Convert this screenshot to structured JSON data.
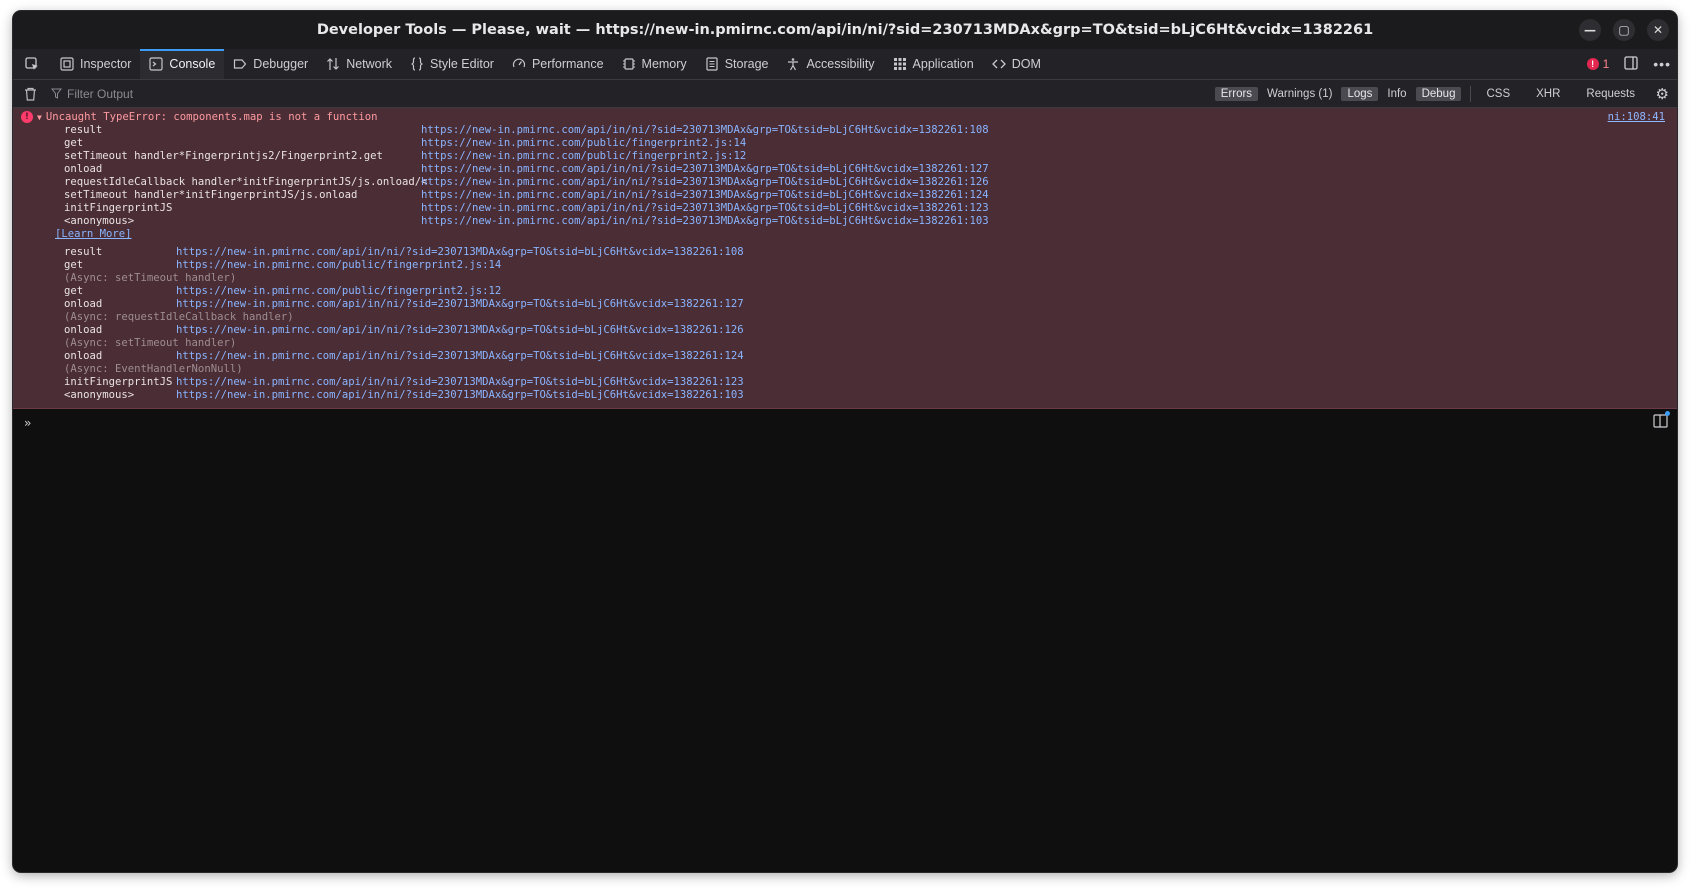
{
  "window": {
    "title": "Developer Tools — Please, wait — https://new-in.pmirnc.com/api/in/ni/?sid=230713MDAx&grp=TO&tsid=bLjC6Ht&vcidx=1382261",
    "controls": {
      "minimize": "—",
      "maximize": "▢",
      "close": "✕"
    }
  },
  "toolbar": {
    "tabs": [
      {
        "label": "Inspector",
        "icon": "inspector-icon"
      },
      {
        "label": "Console",
        "icon": "console-icon",
        "selected": true
      },
      {
        "label": "Debugger",
        "icon": "debugger-icon"
      },
      {
        "label": "Network",
        "icon": "network-icon"
      },
      {
        "label": "Style Editor",
        "icon": "style-editor-icon"
      },
      {
        "label": "Performance",
        "icon": "performance-icon"
      },
      {
        "label": "Memory",
        "icon": "memory-icon"
      },
      {
        "label": "Storage",
        "icon": "storage-icon"
      },
      {
        "label": "Accessibility",
        "icon": "accessibility-icon"
      },
      {
        "label": "Application",
        "icon": "application-icon"
      },
      {
        "label": "DOM",
        "icon": "dom-icon"
      }
    ],
    "error_count": "1"
  },
  "filterbar": {
    "placeholder": "Filter Output",
    "buttons": [
      {
        "label": "Errors",
        "on": true
      },
      {
        "label": "Warnings (1)",
        "on": false
      },
      {
        "label": "Logs",
        "on": true
      },
      {
        "label": "Info",
        "on": false
      },
      {
        "label": "Debug",
        "on": true
      }
    ],
    "net_buttons": [
      "CSS",
      "XHR",
      "Requests"
    ]
  },
  "error": {
    "message": "Uncaught TypeError: components.map is not a function",
    "location": "ni:108:41",
    "stack": [
      {
        "fn": "result",
        "url": "https://new-in.pmirnc.com/api/in/ni/?sid=230713MDAx&grp=TO&tsid=bLjC6Ht&vcidx=1382261:108"
      },
      {
        "fn": "get",
        "url": "https://new-in.pmirnc.com/public/fingerprint2.js:14"
      },
      {
        "fn": "setTimeout handler*Fingerprintjs2/Fingerprint2.get",
        "url": "https://new-in.pmirnc.com/public/fingerprint2.js:12"
      },
      {
        "fn": "onload",
        "url": "https://new-in.pmirnc.com/api/in/ni/?sid=230713MDAx&grp=TO&tsid=bLjC6Ht&vcidx=1382261:127"
      },
      {
        "fn": "requestIdleCallback handler*initFingerprintJS/js.onload/<",
        "url": "https://new-in.pmirnc.com/api/in/ni/?sid=230713MDAx&grp=TO&tsid=bLjC6Ht&vcidx=1382261:126"
      },
      {
        "fn": "setTimeout handler*initFingerprintJS/js.onload",
        "url": "https://new-in.pmirnc.com/api/in/ni/?sid=230713MDAx&grp=TO&tsid=bLjC6Ht&vcidx=1382261:124"
      },
      {
        "fn": "initFingerprintJS",
        "url": "https://new-in.pmirnc.com/api/in/ni/?sid=230713MDAx&grp=TO&tsid=bLjC6Ht&vcidx=1382261:123"
      },
      {
        "fn": "<anonymous>",
        "url": "https://new-in.pmirnc.com/api/in/ni/?sid=230713MDAx&grp=TO&tsid=bLjC6Ht&vcidx=1382261:103"
      }
    ],
    "learn_more": "[Learn More]",
    "async_trace": [
      {
        "fn": "result",
        "url": "https://new-in.pmirnc.com/api/in/ni/?sid=230713MDAx&grp=TO&tsid=bLjC6Ht&vcidx=1382261:108"
      },
      {
        "fn": "get",
        "url": "https://new-in.pmirnc.com/public/fingerprint2.js:14"
      },
      {
        "async": "(Async: setTimeout handler)"
      },
      {
        "fn": "get",
        "url": "https://new-in.pmirnc.com/public/fingerprint2.js:12"
      },
      {
        "fn": "onload",
        "url": "https://new-in.pmirnc.com/api/in/ni/?sid=230713MDAx&grp=TO&tsid=bLjC6Ht&vcidx=1382261:127"
      },
      {
        "async": "(Async: requestIdleCallback handler)"
      },
      {
        "fn": "onload",
        "url": "https://new-in.pmirnc.com/api/in/ni/?sid=230713MDAx&grp=TO&tsid=bLjC6Ht&vcidx=1382261:126"
      },
      {
        "async": "(Async: setTimeout handler)"
      },
      {
        "fn": "onload",
        "url": "https://new-in.pmirnc.com/api/in/ni/?sid=230713MDAx&grp=TO&tsid=bLjC6Ht&vcidx=1382261:124"
      },
      {
        "async": "(Async: EventHandlerNonNull)"
      },
      {
        "fn": "initFingerprintJS",
        "url": "https://new-in.pmirnc.com/api/in/ni/?sid=230713MDAx&grp=TO&tsid=bLjC6Ht&vcidx=1382261:123"
      },
      {
        "fn": "<anonymous>",
        "url": "https://new-in.pmirnc.com/api/in/ni/?sid=230713MDAx&grp=TO&tsid=bLjC6Ht&vcidx=1382261:103"
      }
    ]
  },
  "input": {
    "prompt": "»"
  }
}
